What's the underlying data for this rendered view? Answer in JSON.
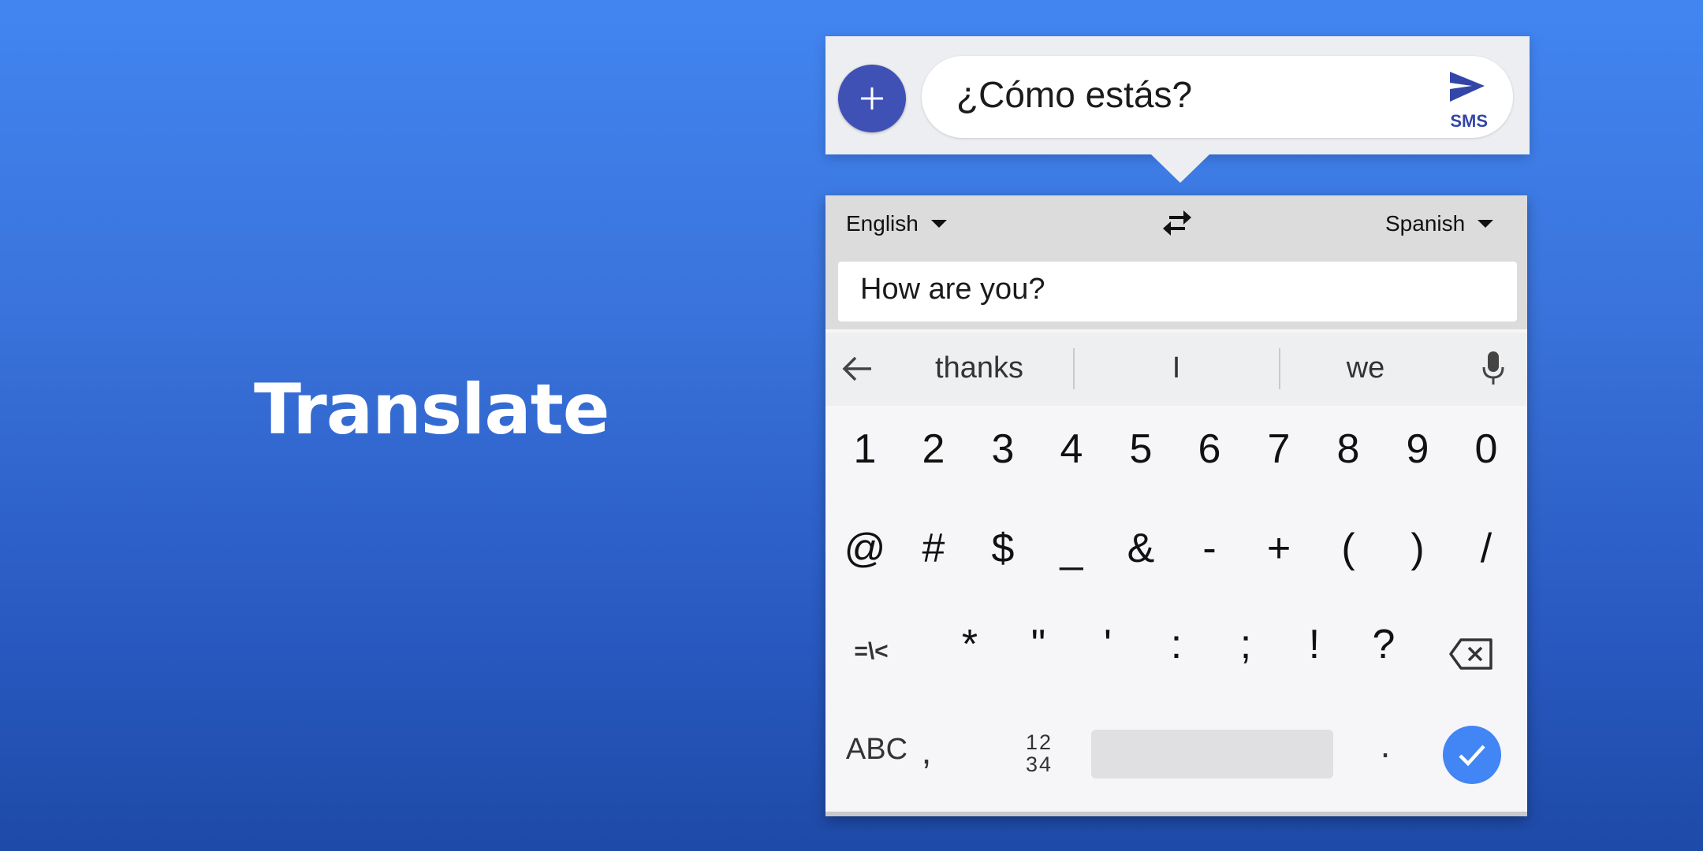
{
  "headline": "Translate",
  "compose": {
    "message_text": "¿Cómo estás?",
    "send_label": "SMS",
    "attach_icon": "plus-icon",
    "send_icon": "send-icon"
  },
  "translator": {
    "source_language": "English",
    "target_language": "Spanish",
    "swap_icon": "swap-icon",
    "source_text": "How are you?"
  },
  "suggestions": {
    "back_icon": "arrow-left-icon",
    "words": [
      "thanks",
      "I",
      "we"
    ],
    "mic_icon": "microphone-icon"
  },
  "keyboard": {
    "row1": [
      "1",
      "2",
      "3",
      "4",
      "5",
      "6",
      "7",
      "8",
      "9",
      "0"
    ],
    "row2": [
      "@",
      "#",
      "$",
      "_",
      "&",
      "-",
      "+",
      "(",
      ")",
      "/"
    ],
    "row3": [
      "=\\<",
      "*",
      "\"",
      "'",
      ":",
      ";",
      "!",
      "?"
    ],
    "row4": {
      "abc": "ABC",
      "comma": ",",
      "numpad_top": "12",
      "numpad_bottom": "34",
      "period": ".",
      "enter_icon": "check-icon",
      "backspace_icon": "backspace-icon"
    }
  },
  "colors": {
    "accent_indigo": "#3f51b5",
    "accent_blue": "#4285f4",
    "background_top": "#4285f1",
    "background_bottom": "#1e4aa8"
  }
}
